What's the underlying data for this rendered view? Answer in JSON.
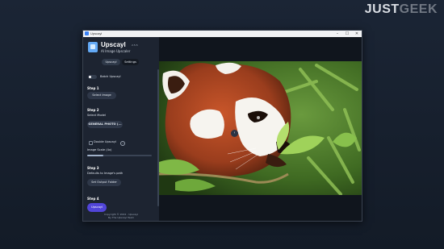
{
  "watermark": {
    "part1": "JUST",
    "part2": "GEEK"
  },
  "window": {
    "title": "Upscayl",
    "controls": {
      "minimize": "–",
      "maximize": "☐",
      "close": "✕"
    }
  },
  "sidebar": {
    "app_name": "Upscayl",
    "version": "2.5.5",
    "subtitle": "AI Image Upscaler",
    "tabs": [
      {
        "label": "Upscayl",
        "active": true
      },
      {
        "label": "Settings",
        "active": false
      }
    ],
    "batch_label": "Batch Upscayl",
    "step1": {
      "title": "Step 1",
      "button": "Select Image"
    },
    "step2": {
      "title": "Step 2",
      "select_model_label": "Select Model",
      "model_value": "GENERAL PHOTO (...",
      "double_label": "Double Upscayl",
      "scale_label": "Image Scale (4x)",
      "scale_level": 0.25
    },
    "step3": {
      "title": "Step 3",
      "desc": "Defaults to Image's path",
      "button": "Set Output Folder"
    },
    "step4": {
      "title": "Step 4",
      "button": "Upscayl"
    },
    "copyright_line1": "Copyright © 2024 - Upscayl",
    "copyright_line2": "By The Upscayl Team"
  },
  "colors": {
    "accent": "#5145d8",
    "sidebar_bg": "#1d2431",
    "pill_bg": "#2e3748"
  },
  "icons": {
    "collapse": "chevron-left-icon",
    "fab": "wrench-icon"
  }
}
